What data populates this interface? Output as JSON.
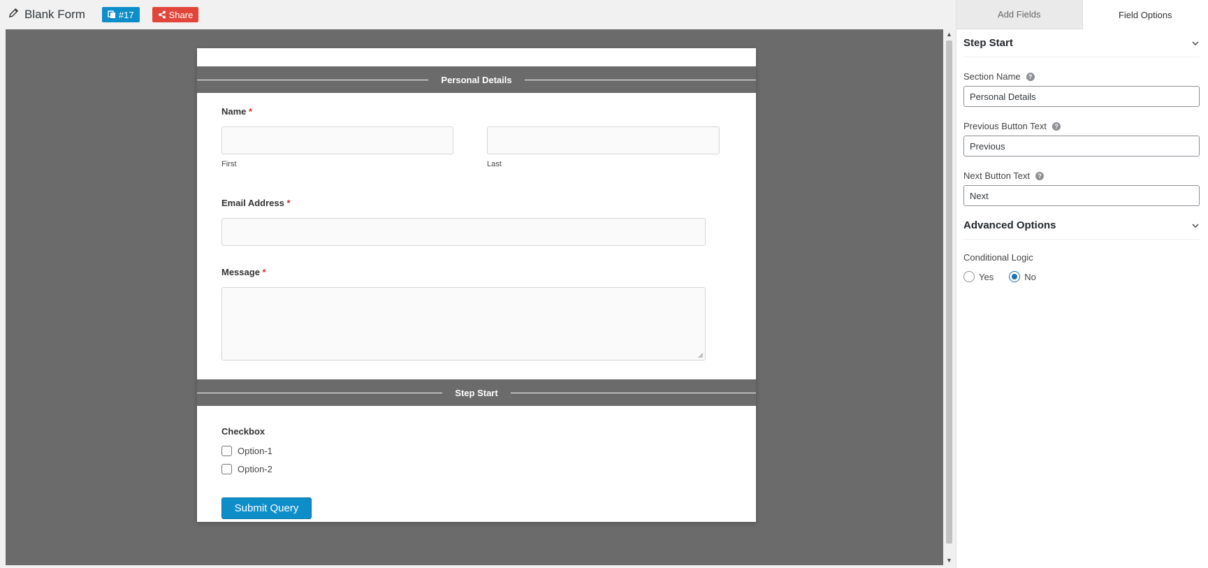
{
  "header": {
    "form_title": "Blank Form",
    "form_id_badge": "#17",
    "share_label": "Share"
  },
  "form": {
    "section1_title": "Personal Details",
    "name_label": "Name",
    "required_mark": "*",
    "first_label": "First",
    "last_label": "Last",
    "email_label": "Email Address",
    "message_label": "Message",
    "section2_title": "Step Start",
    "checkbox_label": "Checkbox",
    "options": [
      "Option-1",
      "Option-2"
    ],
    "submit_label": "Submit Query"
  },
  "panel": {
    "tabs": [
      {
        "label": "Add Fields",
        "active": false
      },
      {
        "label": "Field Options",
        "active": true
      }
    ],
    "group1_title": "Step Start",
    "section_name_label": "Section Name",
    "section_name_value": "Personal Details",
    "prev_label": "Previous Button Text",
    "prev_value": "Previous",
    "next_label": "Next Button Text",
    "next_value": "Next",
    "group2_title": "Advanced Options",
    "conditional_label": "Conditional Logic",
    "yes_label": "Yes",
    "no_label": "No",
    "selected": "No"
  },
  "colors": {
    "accent": "#0e8ec9",
    "share": "#e1463b",
    "canvas": "#6b6b6b",
    "required": "#e02b27"
  }
}
